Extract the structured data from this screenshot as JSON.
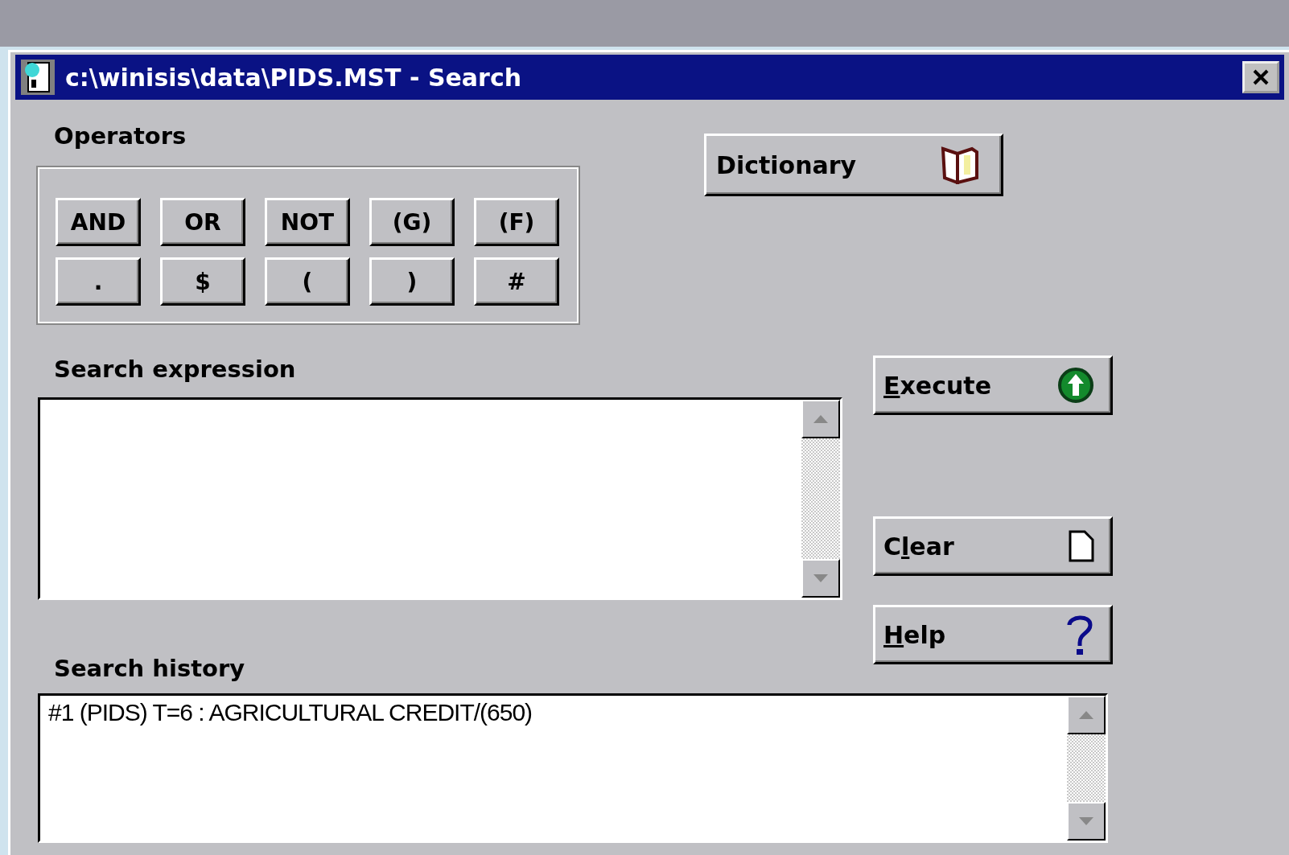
{
  "window": {
    "title": "c:\\winisis\\data\\PIDS.MST - Search"
  },
  "operators": {
    "label": "Operators",
    "buttons": [
      "AND",
      "OR",
      "NOT",
      "(G)",
      "(F)",
      ".",
      "$",
      "(",
      ")",
      "#"
    ]
  },
  "dictionary_button": {
    "label": "Dictionary"
  },
  "search_expression": {
    "label": "Search expression"
  },
  "actions": [
    {
      "kind": "execute",
      "access_key": "E",
      "text_after": "xecute"
    },
    {
      "kind": "clear",
      "text_before": "C",
      "access_key": "l",
      "text_after": "ear"
    },
    {
      "kind": "help",
      "access_key": "H",
      "text_after": "elp"
    }
  ],
  "search_history": {
    "label": "Search history",
    "lines": [
      "#1 (PIDS) T=6 : AGRICULTURAL CREDIT/(650)"
    ]
  }
}
